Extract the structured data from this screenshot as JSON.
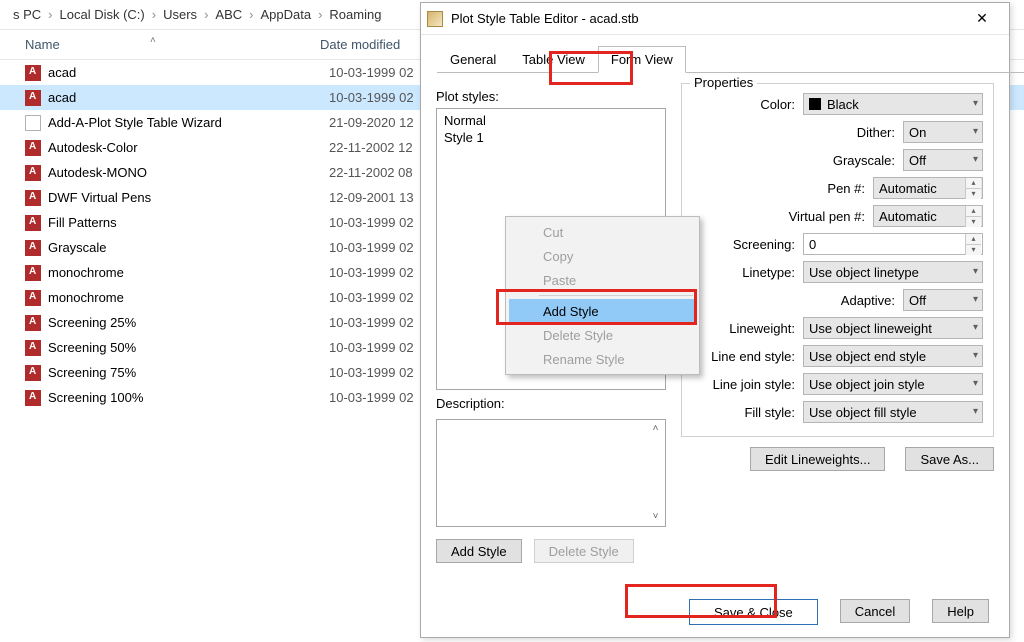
{
  "breadcrumb": [
    "s PC",
    "Local Disk (C:)",
    "Users",
    "ABC",
    "AppData",
    "Roaming"
  ],
  "explorer": {
    "col_name": "Name",
    "col_date": "Date modified",
    "files": [
      {
        "name": "acad",
        "date": "10-03-1999 02",
        "icon": "stb",
        "selected": false
      },
      {
        "name": "acad",
        "date": "10-03-1999 02",
        "icon": "stb",
        "selected": true
      },
      {
        "name": "Add-A-Plot Style Table Wizard",
        "date": "21-09-2020 12",
        "icon": "wizard",
        "selected": false
      },
      {
        "name": "Autodesk-Color",
        "date": "22-11-2002 12",
        "icon": "stb",
        "selected": false
      },
      {
        "name": "Autodesk-MONO",
        "date": "22-11-2002 08",
        "icon": "stb",
        "selected": false
      },
      {
        "name": "DWF Virtual Pens",
        "date": "12-09-2001 13",
        "icon": "stb",
        "selected": false
      },
      {
        "name": "Fill Patterns",
        "date": "10-03-1999 02",
        "icon": "stb",
        "selected": false
      },
      {
        "name": "Grayscale",
        "date": "10-03-1999 02",
        "icon": "stb",
        "selected": false
      },
      {
        "name": "monochrome",
        "date": "10-03-1999 02",
        "icon": "stb",
        "selected": false
      },
      {
        "name": "monochrome",
        "date": "10-03-1999 02",
        "icon": "stb",
        "selected": false
      },
      {
        "name": "Screening 25%",
        "date": "10-03-1999 02",
        "icon": "stb",
        "selected": false
      },
      {
        "name": "Screening 50%",
        "date": "10-03-1999 02",
        "icon": "stb",
        "selected": false
      },
      {
        "name": "Screening 75%",
        "date": "10-03-1999 02",
        "icon": "stb",
        "selected": false
      },
      {
        "name": "Screening 100%",
        "date": "10-03-1999 02",
        "icon": "stb",
        "selected": false
      }
    ]
  },
  "dialog": {
    "title": "Plot Style Table Editor - acad.stb",
    "tabs": {
      "general": "General",
      "table": "Table View",
      "form": "Form View"
    },
    "plot_styles_label": "Plot styles:",
    "plot_styles": [
      "Normal",
      "Style 1"
    ],
    "description_label": "Description:",
    "add_style_btn": "Add Style",
    "delete_style_btn": "Delete Style",
    "edit_lineweights_btn": "Edit Lineweights...",
    "save_as_btn": "Save As...",
    "save_close_btn": "Save & Close",
    "cancel_btn": "Cancel",
    "help_btn": "Help",
    "properties": {
      "group": "Properties",
      "color_label": "Color:",
      "color_value": "Black",
      "dither_label": "Dither:",
      "dither_value": "On",
      "grayscale_label": "Grayscale:",
      "grayscale_value": "Off",
      "pen_label": "Pen #:",
      "pen_value": "Automatic",
      "vpen_label": "Virtual pen #:",
      "vpen_value": "Automatic",
      "screening_label": "Screening:",
      "screening_value": "0",
      "linetype_label": "Linetype:",
      "linetype_value": "Use object linetype",
      "adaptive_label": "Adaptive:",
      "adaptive_value": "Off",
      "lineweight_label": "Lineweight:",
      "lineweight_value": "Use object lineweight",
      "endstyle_label": "Line end style:",
      "endstyle_value": "Use object end style",
      "joinstyle_label": "Line join style:",
      "joinstyle_value": "Use object join style",
      "fillstyle_label": "Fill style:",
      "fillstyle_value": "Use object fill style"
    }
  },
  "ctxmenu": {
    "cut": "Cut",
    "copy": "Copy",
    "paste": "Paste",
    "add": "Add Style",
    "delete": "Delete Style",
    "rename": "Rename Style"
  }
}
